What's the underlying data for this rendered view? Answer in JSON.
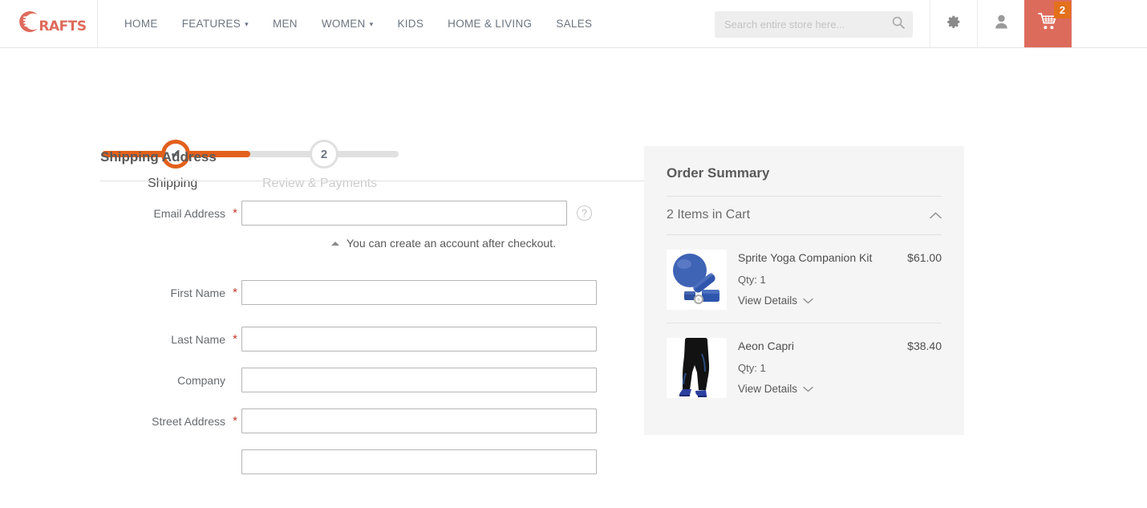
{
  "header": {
    "logo_text": "RAFTS",
    "logo_icon": "crafts-hand-logo",
    "nav": [
      {
        "label": "HOME",
        "caret": false
      },
      {
        "label": "FEATURES",
        "caret": true
      },
      {
        "label": "MEN",
        "caret": false
      },
      {
        "label": "WOMEN",
        "caret": true
      },
      {
        "label": "KIDS",
        "caret": false
      },
      {
        "label": "HOME & LIVING",
        "caret": false
      },
      {
        "label": "SALES",
        "caret": false
      }
    ],
    "caret_glyph": "⌄",
    "search": {
      "placeholder": "Search entire store here...",
      "value": ""
    },
    "cart_count": "2",
    "accent_color": "#dd6b5c",
    "badge_color": "#e3701b"
  },
  "progress": {
    "step1": {
      "number": "1",
      "label": "Shipping",
      "state": "complete",
      "glyph": "✔"
    },
    "step2": {
      "number": "2",
      "label": "Review & Payments",
      "state": "inactive"
    },
    "active_color": "#e2601c",
    "inactive_color": "#e0e0e0"
  },
  "shipping": {
    "section_title": "Shipping Address",
    "required_mark": "*",
    "email": {
      "label": "Email Address",
      "value": "",
      "placeholder": "",
      "help_glyph": "?",
      "hint": "You can create an account after checkout."
    },
    "fields": [
      {
        "label": "First Name",
        "required": true,
        "value": "",
        "placeholder": ""
      },
      {
        "label": "Last Name",
        "required": true,
        "value": "",
        "placeholder": ""
      },
      {
        "label": "Company",
        "required": false,
        "value": "",
        "placeholder": ""
      },
      {
        "label": "Street Address",
        "required": true,
        "value": "",
        "placeholder": ""
      }
    ],
    "street_line2": {
      "value": "",
      "placeholder": ""
    }
  },
  "order_summary": {
    "title": "Order Summary",
    "items_header": "2 Items in Cart",
    "collapse_glyph": "⌃",
    "expand_glyph": "⌄",
    "view_details_label": "View Details",
    "items": [
      {
        "name": "Sprite Yoga Companion Kit",
        "price": "$61.00",
        "qty": "Qty: 1",
        "thumb": "yoga-kit-thumbnail"
      },
      {
        "name": "Aeon Capri",
        "price": "$38.40",
        "qty": "Qty: 1",
        "thumb": "capri-leggings-thumbnail"
      }
    ],
    "panel_color": "#f5f5f5"
  }
}
